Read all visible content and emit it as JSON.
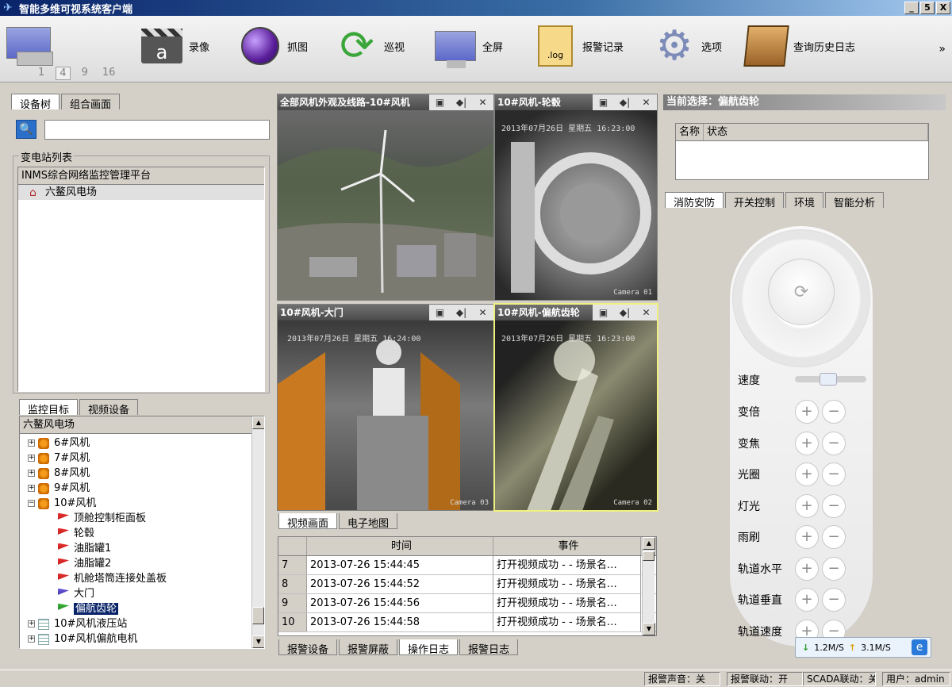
{
  "window": {
    "title": "智能多维可视系统客户端",
    "min": "_",
    "max": "5",
    "close": "X"
  },
  "toolbar": {
    "layout_options": [
      "1",
      "4",
      "9",
      "16"
    ],
    "record": "录像",
    "snapshot": "抓图",
    "tour": "巡视",
    "fullscreen": "全屏",
    "alarm_record": "报警记录",
    "log_icon_text": ".log",
    "options": "选项",
    "history_log": "查询历史日志",
    "more": "»"
  },
  "left": {
    "tabs": [
      "设备树",
      "组合画面"
    ],
    "search_value": "",
    "station_list_label": "变电站列表",
    "station_header": "INMS综合网络监控管理平台",
    "station_item": "六鳌风电场",
    "bottom_tabs": [
      "监控目标",
      "视频设备"
    ],
    "tree_header": "六鳌风电场",
    "tree": [
      {
        "label": "6#风机",
        "icon": "fan"
      },
      {
        "label": "7#风机",
        "icon": "fan"
      },
      {
        "label": "8#风机",
        "icon": "fan"
      },
      {
        "label": "9#风机",
        "icon": "fan"
      },
      {
        "label": "10#风机",
        "icon": "fan"
      },
      {
        "label": "顶舱控制柜面板",
        "icon": "flag-red"
      },
      {
        "label": "轮毂",
        "icon": "flag-red"
      },
      {
        "label": "油脂罐1",
        "icon": "flag-red"
      },
      {
        "label": "油脂罐2",
        "icon": "flag-red"
      },
      {
        "label": "机舱塔筒连接处盖板",
        "icon": "flag-red"
      },
      {
        "label": "大门",
        "icon": "flag-blue"
      },
      {
        "label": "偏航齿轮",
        "icon": "flag-green"
      },
      {
        "label": "10#风机液压站",
        "icon": "grid"
      },
      {
        "label": "10#风机偏航电机",
        "icon": "grid"
      }
    ]
  },
  "videos": [
    {
      "title": "全部风机外观及线路-10#风机",
      "osd": "",
      "cam": ""
    },
    {
      "title": "10#风机-轮毂",
      "osd": "2013年07月26日 星期五 16:23:00",
      "cam": "Camera 01"
    },
    {
      "title": "10#风机-大门",
      "osd": "2013年07月26日 星期五 16:24:00",
      "cam": "Camera 03"
    },
    {
      "title": "10#风机-偏航齿轮",
      "osd": "2013年07月26日 星期五 16:23:00",
      "cam": "Camera 02"
    }
  ],
  "video_ctrl_icons": [
    "▣",
    "◆|",
    "✕"
  ],
  "view_tabs": [
    "视频画面",
    "电子地图"
  ],
  "log": {
    "headers": [
      "",
      "时间",
      "事件"
    ],
    "rows": [
      {
        "idx": "7",
        "time": "2013-07-26 15:44:45",
        "event": "打开视频成功 - - 场景名…"
      },
      {
        "idx": "8",
        "time": "2013-07-26 15:44:52",
        "event": "打开视频成功 - - 场景名…"
      },
      {
        "idx": "9",
        "time": "2013-07-26 15:44:56",
        "event": "打开视频成功 - - 场景名…"
      },
      {
        "idx": "10",
        "time": "2013-07-26 15:44:58",
        "event": "打开视频成功 - - 场景名…"
      }
    ],
    "tabs": [
      "报警设备",
      "报警屏蔽",
      "操作日志",
      "报警日志"
    ]
  },
  "right": {
    "current_label": "当前选择：偏航齿轮",
    "status_headers": [
      "名称",
      "状态"
    ],
    "tabs": [
      "消防安防",
      "开关控制",
      "环境",
      "智能分析"
    ],
    "ptz_labels": [
      "速度",
      "变倍",
      "变焦",
      "光圈",
      "灯光",
      "雨刷",
      "轨道水平",
      "轨道垂直",
      "轨道速度"
    ],
    "speed_level": 0.45,
    "center_glyph": "⟳"
  },
  "speed": {
    "down": "1.2M/S",
    "up": "3.1M/S",
    "down_arrow": "↓",
    "up_arrow": "↑"
  },
  "status": {
    "alarm_sound": "报警声音：关",
    "alarm_link": "报警联动：开",
    "scada": "SCADA联动：关",
    "user": "用户：admin"
  }
}
